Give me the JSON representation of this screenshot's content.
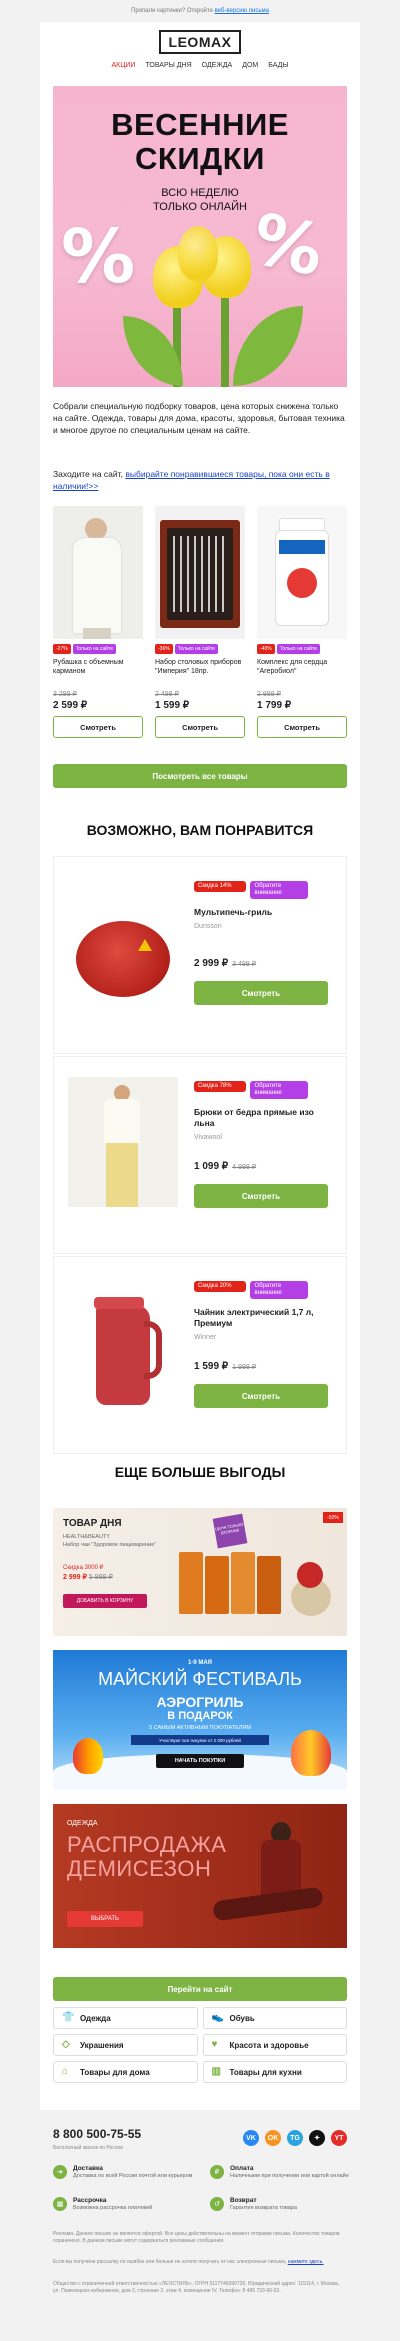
{
  "preheader": {
    "text": "Пропали картинки? Откройте",
    "link": "веб-версию письма"
  },
  "logo": "LEOMAX",
  "nav": [
    "АКЦИИ",
    "ТОВАРЫ ДНЯ",
    "ОДЕЖДА",
    "ДОМ",
    "БАДЫ"
  ],
  "hero": {
    "title_line1": "ВЕСЕННИЕ",
    "title_line2": "СКИДКИ",
    "sub_line1": "ВСЮ НЕДЕЛЮ",
    "sub_line2": "ТОЛЬКО ОНЛАЙН"
  },
  "intro": {
    "text": "Собрали специальную подборку товаров, цена которых снижена только на сайте. Одежда, товары для дома, красоты, здоровья, бытовая техника и многое другое по специальным ценам на сайте.",
    "text2": "Заходите на сайт,",
    "link": "выбирайте понравившиеся товары, пока они есть в наличии!>>"
  },
  "products": [
    {
      "discount": "-27%",
      "badge": "Только на сайте",
      "name": "Рубашка с объемным карманом",
      "old": "3 299 ₽",
      "new": "2 599 ₽",
      "button": "Смотреть"
    },
    {
      "discount": "-36%",
      "badge": "Только на сайте",
      "name": "Набор столовых приборов \"Империя\" 18пр.",
      "old": "2 499 ₽",
      "new": "1 599 ₽",
      "button": "Смотреть"
    },
    {
      "discount": "-40%",
      "badge": "Только на сайте",
      "name": "Комплекс для сердца \"Агеробиол\"",
      "old": "2 999 ₽",
      "new": "1 799 ₽",
      "button": "Смотреть"
    }
  ],
  "all_products_button": "Посмотреть все товары",
  "rec_title": "ВОЗМОЖНО, ВАМ ПОНРАВИТСЯ",
  "recommendations": [
    {
      "tag1": "Скидка 14%",
      "tag2": "Обратите внимание",
      "name": "Мультипечь-гриль",
      "brand": "Dunsson",
      "price": "2 999 ₽",
      "old": "3 499 ₽",
      "button": "Смотреть"
    },
    {
      "tag1": "Скидка 78%",
      "tag2": "Обратите внимание",
      "name": "Брюки от бедра прямые изо льна",
      "brand": "Vivawool",
      "price": "1 099 ₽",
      "old": "4 999 ₽",
      "button": "Смотреть"
    },
    {
      "tag1": "Скидка 20%",
      "tag2": "Обратите внимание",
      "name": "Чайник электрический 1,7 л, Премиум",
      "brand": "Winner",
      "price": "1 599 ₽",
      "old": "1 999 ₽",
      "button": "Смотреть"
    }
  ],
  "more_title": "ЕЩЕ БОЛЬШЕ ВЫГОДЫ",
  "banner1": {
    "title": "ТОВАР ДНЯ",
    "brand": "HEALTH&BEAUTY",
    "subtitle": "Набор чаи \"Здоровое пищеварение\"",
    "label": "Скидка 3000 ₽",
    "price": "2 999 ₽",
    "old": "5 999 ₽",
    "button": "ДОБАВИТЬ В КОРЗИНУ",
    "sticker": "ЦЕНА ТОЛЬКО ВТОРНИК",
    "percent": "-50%"
  },
  "banner2": {
    "date": "1-9 МАЯ",
    "title": "МАЙСКИЙ ФЕСТИВАЛЬ",
    "gift1": "АЭРОГРИЛЬ",
    "gift2": "В ПОДАРОК",
    "gift3": "5 САМЫМ АКТИВНЫМ ПОКУПАТЕЛЯМ",
    "note": "Участвуют все покупки от 2 000 рублей",
    "button": "НАЧАТЬ ПОКУПКИ"
  },
  "banner3": {
    "small": "ОДЕЖДА",
    "title1": "РАСПРОДАЖА",
    "title2": "ДЕМИСЕЗОН",
    "button": "ВЫБРАТЬ"
  },
  "site_button": "Перейти на сайт",
  "categories": [
    "Одежда",
    "Обувь",
    "Украшения",
    "Красота и здоровье",
    "Товары для дома",
    "Товары для кухни"
  ],
  "footer": {
    "phone": "8 800 500-75-55",
    "phone_sub": "Бесплатный звонок по России",
    "socials": [
      "VK",
      "OK",
      "TG",
      "✦",
      "YT"
    ],
    "info": [
      {
        "title": "Доставка",
        "desc": "Доставка по всей России почтой или курьером"
      },
      {
        "title": "Оплата",
        "desc": "Наличными при получении или картой онлайн"
      },
      {
        "title": "Рассрочка",
        "desc": "Возможна рассрочка платежей"
      },
      {
        "title": "Возврат",
        "desc": "Гарантия возврата товара"
      }
    ],
    "legal1": "Реклама. Данное письмо не является офертой. Все цены действительны на момент отправки письма. Количество товаров ограничено. В данном письме могут содержаться рекламные сообщения.",
    "legal2": "Если вы получили рассылку по ошибке или больше не хотите получать от нас электронные письма,",
    "unsubscribe": "нажмите здесь.",
    "legal3": "Общество с ограниченной ответственностью «ЛЕОСТИЛЬ». ОГРН 5117746090726. Юридический адрес: 115114, г. Москва, ул. Павелецкая набережная, дом 2, строение 2, этаж 4, помещение IV. Телефон: 8 495 733-96-03."
  }
}
